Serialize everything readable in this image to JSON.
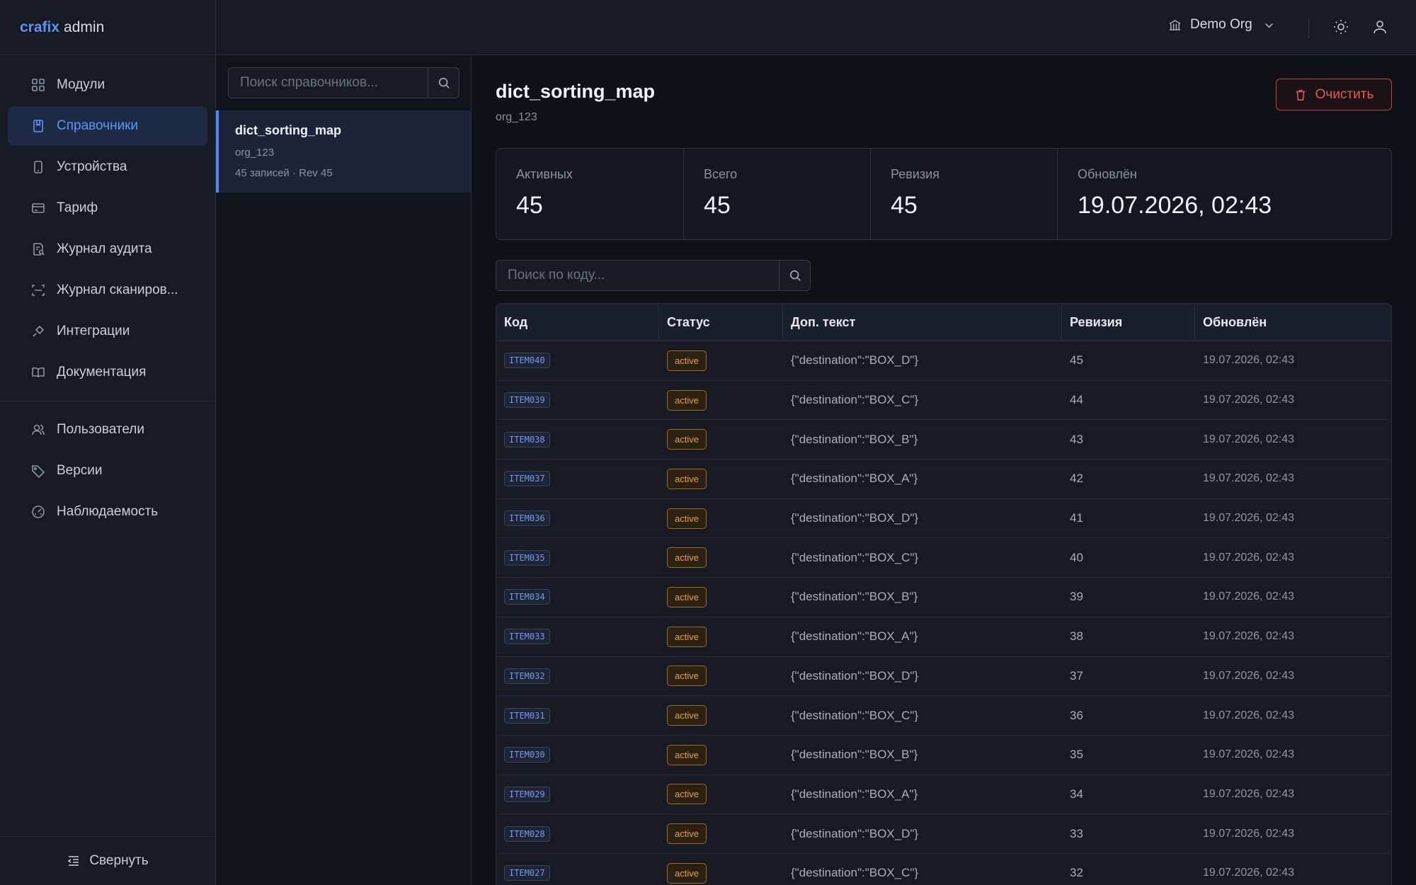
{
  "brand": {
    "name": "crafix",
    "suffix": "admin"
  },
  "sidebar": {
    "items": [
      {
        "label": "Модули",
        "icon": "grid-icon"
      },
      {
        "label": "Справочники",
        "icon": "book-icon",
        "active": true
      },
      {
        "label": "Устройства",
        "icon": "device-icon"
      },
      {
        "label": "Тариф",
        "icon": "credit-card-icon"
      },
      {
        "label": "Журнал аудита",
        "icon": "audit-log-icon"
      },
      {
        "label": "Журнал сканиров...",
        "icon": "scan-icon"
      },
      {
        "label": "Интеграции",
        "icon": "plug-icon"
      },
      {
        "label": "Документация",
        "icon": "open-book-icon"
      }
    ],
    "items2": [
      {
        "label": "Пользователи",
        "icon": "users-icon"
      },
      {
        "label": "Версии",
        "icon": "tag-icon"
      },
      {
        "label": "Наблюдаемость",
        "icon": "gauge-icon"
      }
    ],
    "collapse_label": "Свернуть"
  },
  "header": {
    "org_name": "Demo Org"
  },
  "dict_list": {
    "search_placeholder": "Поиск справочников...",
    "items": [
      {
        "name": "dict_sorting_map",
        "org": "org_123",
        "meta": "45 записей · Rev 45"
      }
    ]
  },
  "main": {
    "title": "dict_sorting_map",
    "subtitle": "org_123",
    "clear_label": "Очистить",
    "stats": [
      {
        "label": "Активных",
        "value": "45"
      },
      {
        "label": "Всего",
        "value": "45"
      },
      {
        "label": "Ревизия",
        "value": "45"
      },
      {
        "label": "Обновлён",
        "value": "19.07.2026, 02:43"
      }
    ],
    "code_search_placeholder": "Поиск по коду...",
    "table": {
      "columns": [
        "Код",
        "Статус",
        "Доп. текст",
        "Ревизия",
        "Обновлён"
      ],
      "rows": [
        {
          "code": "ITEM040",
          "status": "active",
          "extra": "{\"destination\":\"BOX_D\"}",
          "rev": "45",
          "updated": "19.07.2026, 02:43"
        },
        {
          "code": "ITEM039",
          "status": "active",
          "extra": "{\"destination\":\"BOX_C\"}",
          "rev": "44",
          "updated": "19.07.2026, 02:43"
        },
        {
          "code": "ITEM038",
          "status": "active",
          "extra": "{\"destination\":\"BOX_B\"}",
          "rev": "43",
          "updated": "19.07.2026, 02:43"
        },
        {
          "code": "ITEM037",
          "status": "active",
          "extra": "{\"destination\":\"BOX_A\"}",
          "rev": "42",
          "updated": "19.07.2026, 02:43"
        },
        {
          "code": "ITEM036",
          "status": "active",
          "extra": "{\"destination\":\"BOX_D\"}",
          "rev": "41",
          "updated": "19.07.2026, 02:43"
        },
        {
          "code": "ITEM035",
          "status": "active",
          "extra": "{\"destination\":\"BOX_C\"}",
          "rev": "40",
          "updated": "19.07.2026, 02:43"
        },
        {
          "code": "ITEM034",
          "status": "active",
          "extra": "{\"destination\":\"BOX_B\"}",
          "rev": "39",
          "updated": "19.07.2026, 02:43"
        },
        {
          "code": "ITEM033",
          "status": "active",
          "extra": "{\"destination\":\"BOX_A\"}",
          "rev": "38",
          "updated": "19.07.2026, 02:43"
        },
        {
          "code": "ITEM032",
          "status": "active",
          "extra": "{\"destination\":\"BOX_D\"}",
          "rev": "37",
          "updated": "19.07.2026, 02:43"
        },
        {
          "code": "ITEM031",
          "status": "active",
          "extra": "{\"destination\":\"BOX_C\"}",
          "rev": "36",
          "updated": "19.07.2026, 02:43"
        },
        {
          "code": "ITEM030",
          "status": "active",
          "extra": "{\"destination\":\"BOX_B\"}",
          "rev": "35",
          "updated": "19.07.2026, 02:43"
        },
        {
          "code": "ITEM029",
          "status": "active",
          "extra": "{\"destination\":\"BOX_A\"}",
          "rev": "34",
          "updated": "19.07.2026, 02:43"
        },
        {
          "code": "ITEM028",
          "status": "active",
          "extra": "{\"destination\":\"BOX_D\"}",
          "rev": "33",
          "updated": "19.07.2026, 02:43"
        },
        {
          "code": "ITEM027",
          "status": "active",
          "extra": "{\"destination\":\"BOX_C\"}",
          "rev": "32",
          "updated": "19.07.2026, 02:43"
        }
      ]
    }
  },
  "colors": {
    "accent": "#5b96f7",
    "danger": "#e35b55",
    "warning": "#e9a23b",
    "background": "#0f1117"
  }
}
